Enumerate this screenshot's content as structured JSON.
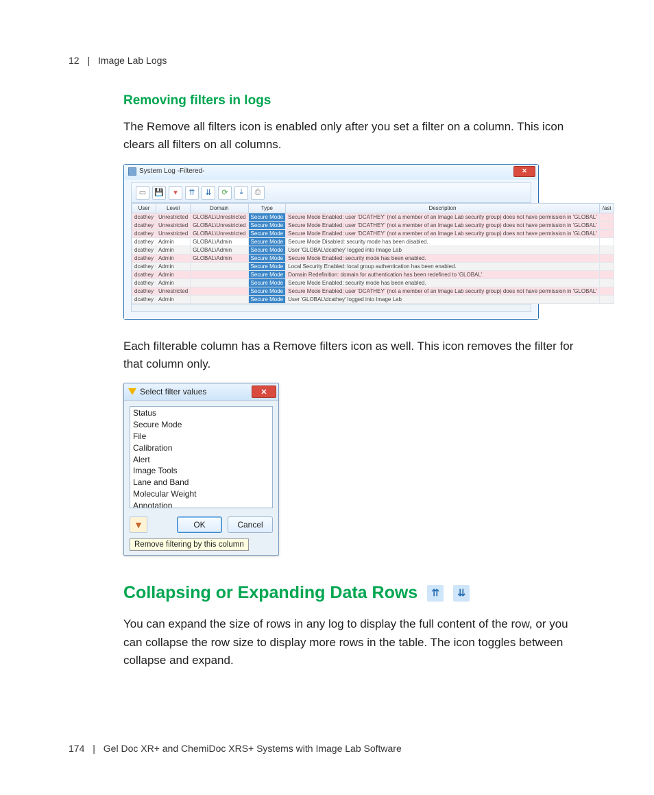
{
  "header": {
    "chapter_num": "12",
    "chapter_title": "Image Lab Logs"
  },
  "section1": {
    "title": "Removing filters in logs",
    "para1": "The Remove all filters icon is enabled only after you set a filter on a column. This icon clears all filters on all columns."
  },
  "syslog": {
    "window_title": "System Log -Filtered-",
    "toolbar_icons": [
      "page-icon",
      "save-icon",
      "remove-filters-icon",
      "collapse-icon",
      "expand-icon",
      "refresh-icon",
      "export-icon",
      "print-icon"
    ],
    "columns": {
      "user": "User",
      "level": "Level",
      "domain": "Domain",
      "type": "Type",
      "description": "Description",
      "last": "/asi"
    },
    "rows": [
      {
        "cls": "pink",
        "user": "dcathey",
        "level": "Unrestricted",
        "domain": "GLOBAL\\Unrestricted",
        "type": "Secure Mode",
        "desc": "Secure Mode Enabled: user 'DCATHEY' (not a member of an Image Lab security group) does not have permission in 'GLOBAL'"
      },
      {
        "cls": "pink",
        "user": "dcathey",
        "level": "Unrestricted",
        "domain": "GLOBAL\\Unrestricted",
        "type": "Secure Mode",
        "desc": "Secure Mode Enabled: user 'DCATHEY' (not a member of an Image Lab security group) does not have permission in 'GLOBAL'"
      },
      {
        "cls": "pink",
        "user": "dcathey",
        "level": "Unrestricted",
        "domain": "GLOBAL\\Unrestricted",
        "type": "Secure Mode",
        "desc": "Secure Mode Enabled: user 'DCATHEY' (not a member of an Image Lab security group) does not have permission in 'GLOBAL'"
      },
      {
        "cls": "white",
        "user": "dcathey",
        "level": "Admin",
        "domain": "GLOBAL\\Admin",
        "type": "Secure Mode",
        "desc": "Secure Mode Disabled: security mode has been disabled."
      },
      {
        "cls": "grey",
        "user": "dcathey",
        "level": "Admin",
        "domain": "GLOBAL\\Admin",
        "type": "Secure Mode",
        "desc": "User 'GLOBAL\\dcathey' logged into Image Lab"
      },
      {
        "cls": "pink",
        "user": "dcathey",
        "level": "Admin",
        "domain": "GLOBAL\\Admin",
        "type": "Secure Mode",
        "desc": "Secure Mode Enabled: security mode has been enabled."
      },
      {
        "cls": "grey",
        "user": "dcathey",
        "level": "Admin",
        "domain": "",
        "type": "Secure Mode",
        "desc": "Local Security Enabled: local group authentication has been enabled."
      },
      {
        "cls": "pink",
        "user": "dcathey",
        "level": "Admin",
        "domain": "",
        "type": "Secure Mode",
        "desc": "Domain Redefinition: domain for authentication has been redefined to 'GLOBAL'."
      },
      {
        "cls": "grey",
        "user": "dcathey",
        "level": "Admin",
        "domain": "",
        "type": "Secure Mode",
        "desc": "Secure Mode Enabled: security mode has been enabled."
      },
      {
        "cls": "pink",
        "user": "dcathey",
        "level": "Unrestricted",
        "domain": "",
        "type": "Secure Mode",
        "desc": "Secure Mode Enabled: user 'DCATHEY' (not a member of an Image Lab security group) does not have permission in 'GLOBAL'"
      },
      {
        "cls": "grey",
        "user": "dcathey",
        "level": "Admin",
        "domain": "",
        "type": "Secure Mode",
        "desc": "User 'GLOBAL\\dcathey' logged into Image Lab"
      }
    ]
  },
  "para2": "Each filterable column has a Remove filters icon as well. This icon removes the filter for that column only.",
  "filterdlg": {
    "title": "Select filter values",
    "items": [
      "Status",
      "Secure Mode",
      "File",
      "Calibration",
      "Alert",
      "Image Tools",
      "Lane and Band",
      "Molecular Weight",
      "Annotation"
    ],
    "ok": "OK",
    "cancel": "Cancel",
    "tooltip": "Remove filtering by this column"
  },
  "section2": {
    "title": "Collapsing or Expanding Data Rows",
    "para": "You can expand the size of rows in any log to display the full content of the row, or you can collapse the row size to display more rows in the table. The icon toggles between collapse and expand."
  },
  "footer": {
    "page": "174",
    "book": "Gel Doc XR+ and ChemiDoc XRS+ Systems with Image Lab Software"
  }
}
